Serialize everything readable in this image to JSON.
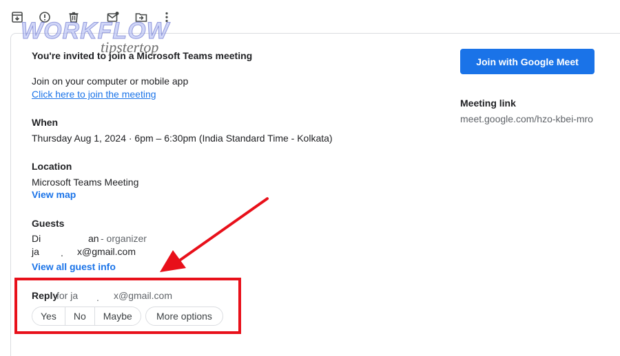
{
  "toolbar": {
    "icons": [
      "archive-icon",
      "report-spam-icon",
      "delete-icon",
      "mark-unread-icon",
      "move-to-icon",
      "more-vert-icon"
    ]
  },
  "watermark": {
    "main": "WORKFLOW",
    "sub": "tipstertop"
  },
  "invite": {
    "title": "You're invited to join a Microsoft Teams meeting",
    "join_text": "Join on your computer or mobile app",
    "join_link": "Click here to join the meeting"
  },
  "when": {
    "label": "When",
    "value": "Thursday Aug 1, 2024 · 6pm – 6:30pm (India Standard Time - Kolkata)"
  },
  "location": {
    "label": "Location",
    "value": "Microsoft Teams Meeting",
    "view_map": "View map"
  },
  "guests": {
    "label": "Guests",
    "organizer_first": "Di",
    "organizer_last": "an",
    "organizer_role": "- organizer",
    "guest_first": "ja",
    "guest_mid": ".",
    "guest_last": "x@gmail.com",
    "view_all": "View all guest info"
  },
  "reply": {
    "label": "Reply",
    "for_text": "for ja",
    "dot": ".",
    "email_tail": "x@gmail.com",
    "yes": "Yes",
    "no": "No",
    "maybe": "Maybe",
    "more": "More options"
  },
  "sidebar": {
    "meet_button": "Join with Google Meet",
    "meeting_link_label": "Meeting link",
    "meeting_link": "meet.google.com/hzo-kbei-mro"
  },
  "colors": {
    "accent": "#1a73e8",
    "annotation_red": "#e8101a"
  }
}
